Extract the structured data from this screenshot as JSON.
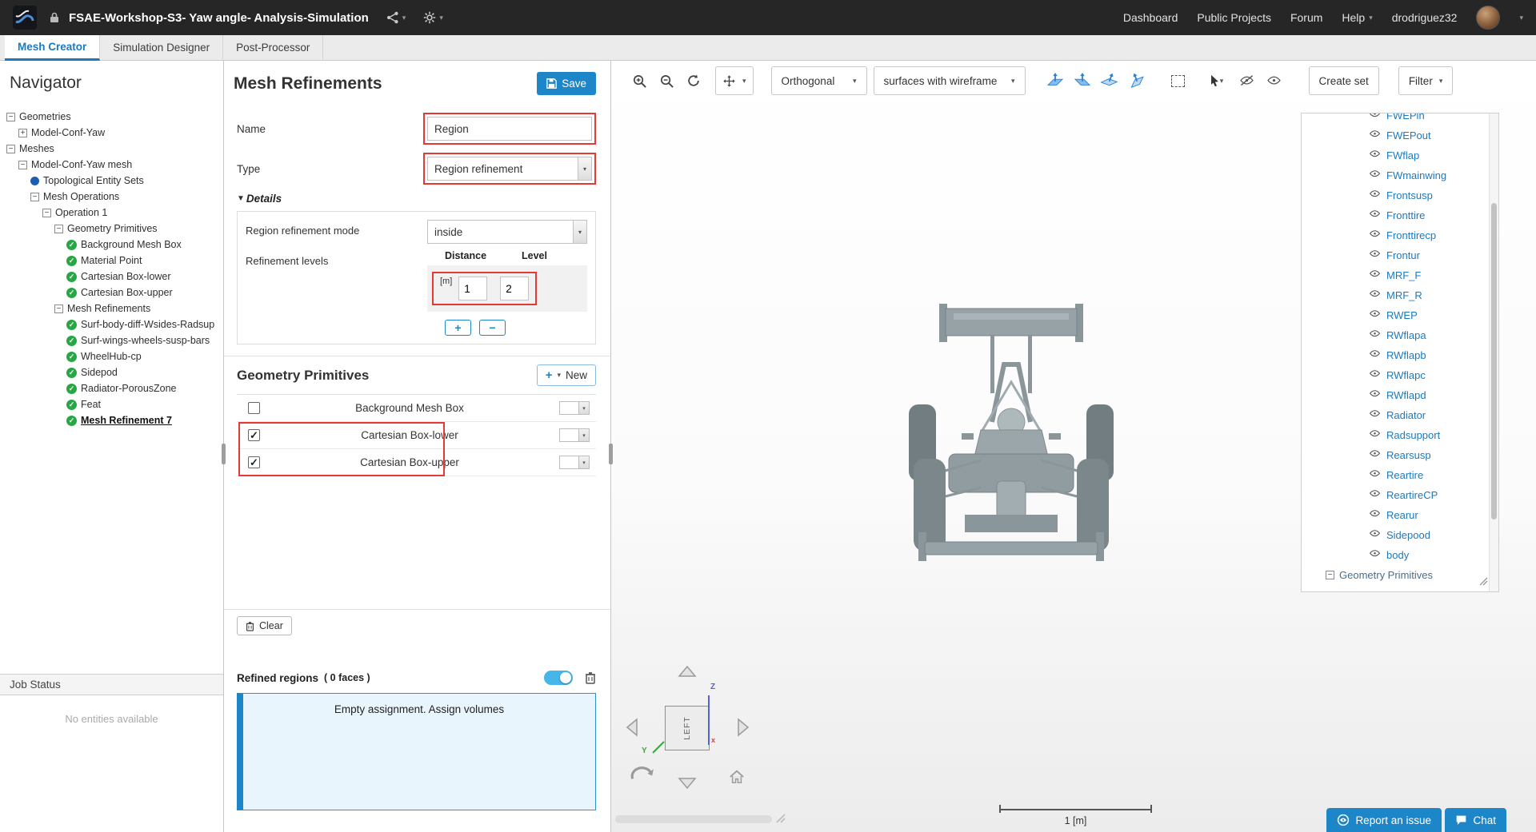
{
  "colors": {
    "accent": "#1d86c9",
    "highlight": "#e53935",
    "link": "#1d79bd",
    "check": "#27a744",
    "toggle": "#45b6e8"
  },
  "topbar": {
    "title": "FSAE-Workshop-S3- Yaw angle- Analysis-Simulation",
    "nav": [
      {
        "label": "Dashboard",
        "caret": false
      },
      {
        "label": "Public Projects",
        "caret": false
      },
      {
        "label": "Forum",
        "caret": false
      },
      {
        "label": "Help",
        "caret": true
      }
    ],
    "user": "drodriguez32"
  },
  "tabs": [
    {
      "label": "Mesh Creator",
      "active": true
    },
    {
      "label": "Simulation Designer",
      "active": false
    },
    {
      "label": "Post-Processor",
      "active": false
    }
  ],
  "navigator": {
    "title": "Navigator",
    "tree": [
      {
        "label": "Geometries",
        "indent": 0,
        "icon": "collapse"
      },
      {
        "label": "Model-Conf-Yaw",
        "indent": 1,
        "icon": "expand"
      },
      {
        "label": "Meshes",
        "indent": 0,
        "icon": "collapse"
      },
      {
        "label": "Model-Conf-Yaw mesh",
        "indent": 1,
        "icon": "collapse"
      },
      {
        "label": "Topological Entity Sets",
        "indent": 2,
        "icon": "bluedot"
      },
      {
        "label": "Mesh Operations",
        "indent": 2,
        "icon": "collapse"
      },
      {
        "label": "Operation 1",
        "indent": 3,
        "icon": "collapse"
      },
      {
        "label": "Geometry Primitives",
        "indent": 4,
        "icon": "collapse"
      },
      {
        "label": "Background Mesh Box",
        "indent": 5,
        "icon": "check"
      },
      {
        "label": "Material Point",
        "indent": 5,
        "icon": "check"
      },
      {
        "label": "Cartesian Box-lower",
        "indent": 5,
        "icon": "check"
      },
      {
        "label": "Cartesian Box-upper",
        "indent": 5,
        "icon": "check"
      },
      {
        "label": "Mesh Refinements",
        "indent": 4,
        "icon": "collapse"
      },
      {
        "label": "Surf-body-diff-Wsides-Radsup",
        "indent": 5,
        "icon": "check"
      },
      {
        "label": "Surf-wings-wheels-susp-bars",
        "indent": 5,
        "icon": "check"
      },
      {
        "label": "WheelHub-cp",
        "indent": 5,
        "icon": "check"
      },
      {
        "label": "Sidepod",
        "indent": 5,
        "icon": "check"
      },
      {
        "label": "Radiator-PorousZone",
        "indent": 5,
        "icon": "check"
      },
      {
        "label": "Feat",
        "indent": 5,
        "icon": "check"
      },
      {
        "label": "Mesh Refinement 7",
        "indent": 5,
        "icon": "check",
        "selected": true
      }
    ],
    "job_status": {
      "title": "Job Status",
      "empty": "No entities available"
    }
  },
  "panel": {
    "title": "Mesh Refinements",
    "save_label": "Save",
    "name_label": "Name",
    "name_value": "Region",
    "type_label": "Type",
    "type_value": "Region refinement",
    "details_label": "Details",
    "mode_label": "Region refinement mode",
    "mode_value": "inside",
    "levels_label": "Refinement levels",
    "distance_header": "Distance",
    "level_header": "Level",
    "unit": "[m]",
    "distance_value": "1",
    "level_value": "2",
    "primitives_title": "Geometry Primitives",
    "new_label": "New",
    "primitives": [
      {
        "label": "Background Mesh Box",
        "checked": false
      },
      {
        "label": "Cartesian Box-lower",
        "checked": true
      },
      {
        "label": "Cartesian Box-upper",
        "checked": true
      }
    ],
    "clear_label": "Clear",
    "refined_label": "Refined regions",
    "faces_label": "( 0 faces )",
    "empty_assignment": "Empty assignment. Assign volumes"
  },
  "viewport": {
    "toolbar": {
      "projection": "Orthogonal",
      "render_mode": "surfaces with wireframe",
      "create_set": "Create set",
      "filter": "Filter"
    },
    "entities": [
      "FWEPin",
      "FWEPout",
      "FWflap",
      "FWmainwing",
      "Frontsusp",
      "Fronttire",
      "Fronttirecp",
      "Frontur",
      "MRF_F",
      "MRF_R",
      "RWEP",
      "RWflapa",
      "RWflapb",
      "RWflapc",
      "RWflapd",
      "Radiator",
      "Radsupport",
      "Rearsusp",
      "Reartire",
      "ReartireCP",
      "Rearur",
      "Sidepood",
      "body"
    ],
    "entities_group": "Geometry Primitives",
    "cube_label": "LEFT",
    "axes": {
      "z": "Z",
      "y": "Y",
      "x": "x"
    },
    "scale_label": "1 [m]",
    "report_issue": "Report an issue",
    "chat_label": "Chat"
  }
}
